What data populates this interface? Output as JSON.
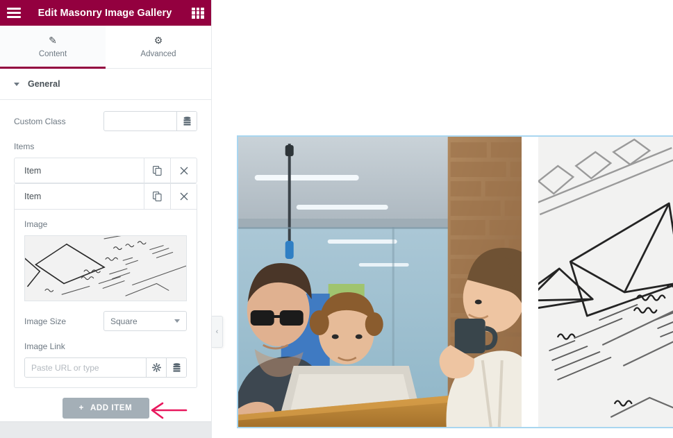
{
  "header": {
    "title": "Edit Masonry Image Gallery",
    "menu_icon": "hamburger-icon",
    "widgets_icon": "grid-icon",
    "background_color": "#93003f"
  },
  "tabs": [
    {
      "label": "Content",
      "icon": "pencil-icon",
      "active": true
    },
    {
      "label": "Advanced",
      "icon": "gear-icon",
      "active": false
    }
  ],
  "section": {
    "title": "General",
    "collapsed": false,
    "caret_icon": "caret-down-icon"
  },
  "controls": {
    "custom_class": {
      "label": "Custom Class",
      "value": "",
      "placeholder": "",
      "dynamic_icon": "database-icon"
    },
    "items_label": "Items",
    "items": [
      {
        "title": "Item",
        "duplicate_icon": "duplicate-icon",
        "remove_icon": "close-icon",
        "open": false
      },
      {
        "title": "Item",
        "duplicate_icon": "duplicate-icon",
        "remove_icon": "close-icon",
        "open": true
      }
    ],
    "item_fields": {
      "image_label": "Image",
      "image_preview": "wireframe-sketch-thumbnail",
      "image_size_label": "Image Size",
      "image_size_value": "Square",
      "image_size_options": [
        "Square"
      ],
      "image_link_label": "Image Link",
      "image_link_value": "",
      "image_link_placeholder": "Paste URL or type",
      "link_options_icon": "gear-icon",
      "link_dynamic_icon": "database-icon"
    },
    "add_item": {
      "label": "ADD ITEM",
      "plus_icon": "plus-icon",
      "color": "#a4afb7"
    }
  },
  "annotation": {
    "type": "arrow-left",
    "color": "#e8185d",
    "points_to": "ADD ITEM"
  },
  "panel_collapse": {
    "icon": "chevron-left-icon",
    "tooltip": ""
  },
  "preview": {
    "selection_color": "#a8d6f0",
    "gallery_items": [
      {
        "alt": "Three colleagues looking at a laptop in a modern office with brick wall"
      },
      {
        "alt": "Close-up of hand-drawn wireframe sketches on paper"
      }
    ]
  }
}
